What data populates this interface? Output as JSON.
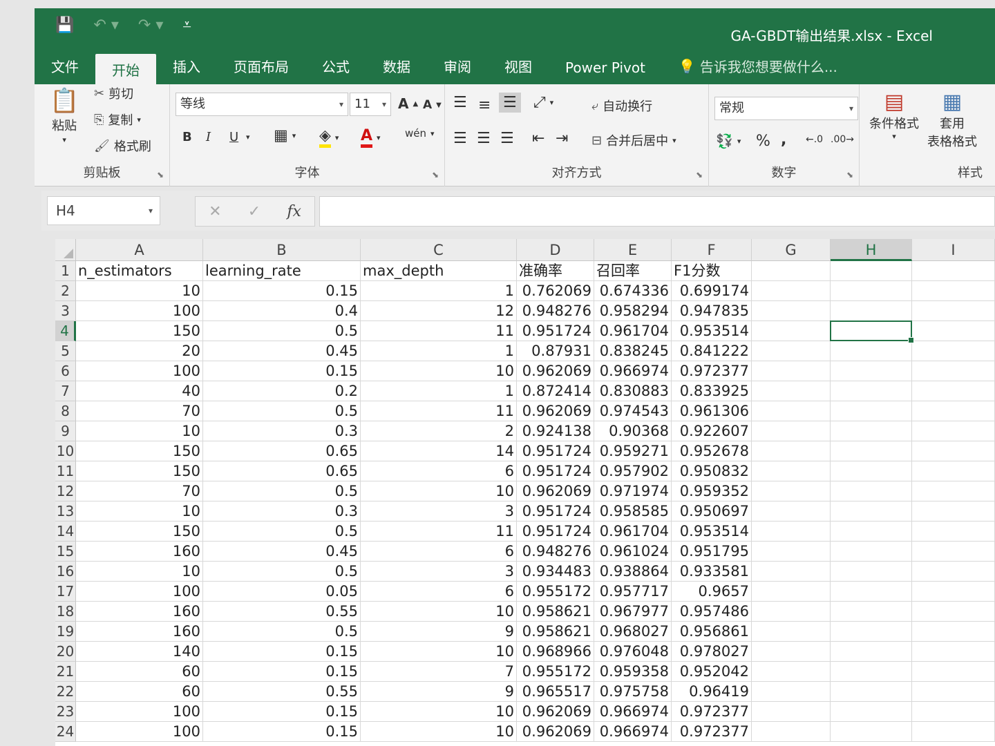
{
  "window": {
    "title": "GA-GBDT输出结果.xlsx - Excel"
  },
  "qat": {
    "save_icon": "save-icon",
    "undo_icon": "undo-icon",
    "redo_icon": "redo-icon",
    "customize_icon": "customize-qat-icon"
  },
  "tabs": [
    "文件",
    "开始",
    "插入",
    "页面布局",
    "公式",
    "数据",
    "审阅",
    "视图",
    "Power Pivot"
  ],
  "active_tab": "开始",
  "tell_me": "告诉我您想要做什么...",
  "clipboard": {
    "paste": "粘贴",
    "cut": "剪切",
    "copy": "复制",
    "format_painter": "格式刷",
    "label": "剪贴板"
  },
  "font": {
    "name": "等线",
    "size": "11",
    "grow": "A",
    "shrink": "A",
    "bold": "B",
    "italic": "I",
    "underline": "U",
    "font_color_glyph": "A",
    "phonetic": "wén",
    "label": "字体"
  },
  "alignment": {
    "wrap": "自动换行",
    "merge": "合并后居中",
    "label": "对齐方式"
  },
  "number": {
    "format": "常规",
    "percent": "%",
    "comma": ",",
    "label": "数字"
  },
  "styles": {
    "conditional": "条件格式",
    "table_line1": "套用",
    "table_line2": "表格格式",
    "label": "样式"
  },
  "formula_bar": {
    "name_box": "H4",
    "cancel": "✕",
    "enter": "✓",
    "fx": "fx",
    "value": ""
  },
  "selected": {
    "col": "H",
    "row": "4"
  },
  "columns": [
    "A",
    "B",
    "C",
    "D",
    "E",
    "F",
    "G",
    "H",
    "I"
  ],
  "sheet": {
    "headers": [
      "n_estimators",
      "learning_rate",
      "max_depth",
      "准确率",
      "召回率",
      "F1分数"
    ],
    "rows": [
      [
        "2",
        "10",
        "0.15",
        "1",
        "0.762069",
        "0.674336",
        "0.699174"
      ],
      [
        "3",
        "100",
        "0.4",
        "12",
        "0.948276",
        "0.958294",
        "0.947835"
      ],
      [
        "4",
        "150",
        "0.5",
        "11",
        "0.951724",
        "0.961704",
        "0.953514"
      ],
      [
        "5",
        "20",
        "0.45",
        "1",
        "0.87931",
        "0.838245",
        "0.841222"
      ],
      [
        "6",
        "100",
        "0.15",
        "10",
        "0.962069",
        "0.966974",
        "0.972377"
      ],
      [
        "7",
        "40",
        "0.2",
        "1",
        "0.872414",
        "0.830883",
        "0.833925"
      ],
      [
        "8",
        "70",
        "0.5",
        "11",
        "0.962069",
        "0.974543",
        "0.961306"
      ],
      [
        "9",
        "10",
        "0.3",
        "2",
        "0.924138",
        "0.90368",
        "0.922607"
      ],
      [
        "10",
        "150",
        "0.65",
        "14",
        "0.951724",
        "0.959271",
        "0.952678"
      ],
      [
        "11",
        "150",
        "0.65",
        "6",
        "0.951724",
        "0.957902",
        "0.950832"
      ],
      [
        "12",
        "70",
        "0.5",
        "10",
        "0.962069",
        "0.971974",
        "0.959352"
      ],
      [
        "13",
        "10",
        "0.3",
        "3",
        "0.951724",
        "0.958585",
        "0.950697"
      ],
      [
        "14",
        "150",
        "0.5",
        "11",
        "0.951724",
        "0.961704",
        "0.953514"
      ],
      [
        "15",
        "160",
        "0.45",
        "6",
        "0.948276",
        "0.961024",
        "0.951795"
      ],
      [
        "16",
        "10",
        "0.5",
        "3",
        "0.934483",
        "0.938864",
        "0.933581"
      ],
      [
        "17",
        "100",
        "0.05",
        "6",
        "0.955172",
        "0.957717",
        "0.9657"
      ],
      [
        "18",
        "160",
        "0.55",
        "10",
        "0.958621",
        "0.967977",
        "0.957486"
      ],
      [
        "19",
        "160",
        "0.5",
        "9",
        "0.958621",
        "0.968027",
        "0.956861"
      ],
      [
        "20",
        "140",
        "0.15",
        "10",
        "0.968966",
        "0.976048",
        "0.978027"
      ],
      [
        "21",
        "60",
        "0.15",
        "7",
        "0.955172",
        "0.959358",
        "0.952042"
      ],
      [
        "22",
        "60",
        "0.55",
        "9",
        "0.965517",
        "0.975758",
        "0.96419"
      ],
      [
        "23",
        "100",
        "0.15",
        "10",
        "0.962069",
        "0.966974",
        "0.972377"
      ],
      [
        "24",
        "100",
        "0.15",
        "10",
        "0.962069",
        "0.966974",
        "0.972377"
      ]
    ]
  },
  "colors": {
    "accent": "#217346",
    "ribbon": "#f3f3f3",
    "header": "#ececec"
  }
}
